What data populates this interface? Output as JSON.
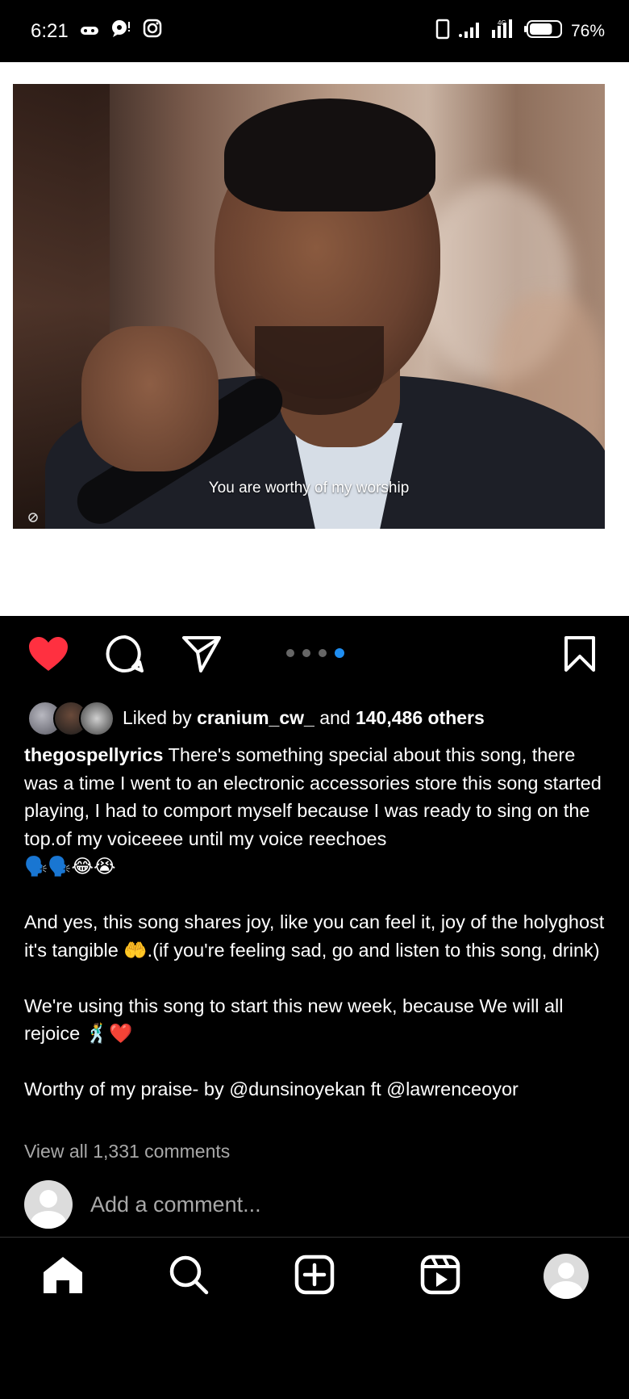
{
  "status_bar": {
    "time": "6:21",
    "battery_percent": "76%",
    "battery_level": 0.76,
    "left_icons": [
      "game-controller-icon",
      "speech-bubble-icon",
      "instagram-icon"
    ],
    "right_icons": [
      "vibrate-icon",
      "signal-icon",
      "data-signal-icon",
      "battery-icon"
    ]
  },
  "post": {
    "media": {
      "subtitle": "You are worthy of my worship",
      "carousel_count": 4,
      "carousel_active_index": 3
    },
    "actions": {
      "like_icon": "heart-filled-icon",
      "comment_icon": "comment-icon",
      "share_icon": "send-icon",
      "save_icon": "bookmark-icon",
      "liked": true,
      "like_color": "#ff3040"
    },
    "likes": {
      "prefix": "Liked by",
      "user": "cranium_cw_",
      "connector": "and",
      "others": "140,486 others"
    },
    "caption": {
      "username": "thegospellyrics",
      "para1": "There's something special about this song, there was a time I went to an electronic accessories store this song started playing,  I had to comport myself because I was ready to sing on the top.of my voiceeee until my voice reechoes",
      "para1_emoji": "🗣️🗣️😂😭",
      "para2": "And yes,  this song shares joy, like you can feel it, joy of the holyghost it's tangible 🤲.(if you're feeling sad, go and listen to this song, drink)",
      "para3": "We're using this song to start this new week, because We will all rejoice 🕺❤️",
      "para4": "Worthy of my praise- by @dunsinoyekan ft @lawrenceoyor"
    },
    "view_comments": "View all 1,331 comments",
    "add_comment_placeholder": "Add a comment..."
  },
  "bottom_nav": {
    "items": [
      "home-icon",
      "search-icon",
      "create-post-icon",
      "reels-icon",
      "profile-avatar"
    ],
    "active": "home-icon"
  },
  "colors": {
    "background": "#000000",
    "muted_text": "#a8a8a8",
    "accent_blue": "#1f8ef1"
  }
}
